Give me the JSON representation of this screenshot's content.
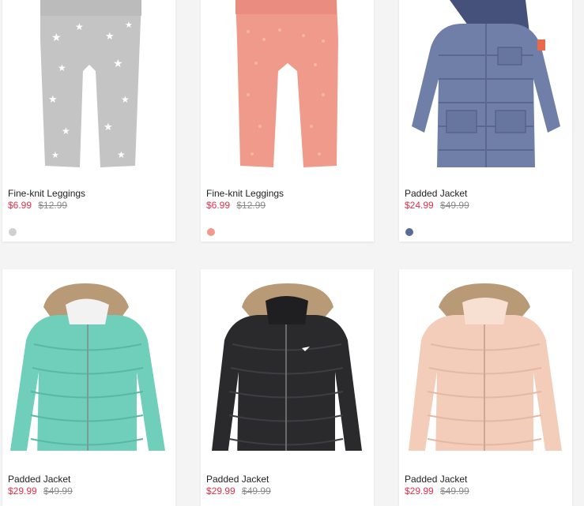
{
  "products": [
    {
      "name": "Fine-knit Leggings",
      "sale_price": "$6.99",
      "original_price": "$12.99",
      "swatch_color": "#cfcfcf",
      "image": "gray-star-leggings"
    },
    {
      "name": "Fine-knit Leggings",
      "sale_price": "$6.99",
      "original_price": "$12.99",
      "swatch_color": "#f2998a",
      "image": "pink-leggings"
    },
    {
      "name": "Padded Jacket",
      "sale_price": "$24.99",
      "original_price": "$49.99",
      "swatch_color": "#5b6b98",
      "image": "blue-padded-jacket"
    },
    {
      "name": "Padded Jacket",
      "sale_price": "$29.99",
      "original_price": "$49.99",
      "image": "mint-fur-hood-jacket"
    },
    {
      "name": "Padded Jacket",
      "sale_price": "$29.99",
      "original_price": "$49.99",
      "image": "black-fur-hood-jacket"
    },
    {
      "name": "Padded Jacket",
      "sale_price": "$29.99",
      "original_price": "$49.99",
      "image": "peach-fur-hood-jacket"
    }
  ],
  "colors": {
    "sale_price": "#e3324a",
    "original_price": "#8a8a8a",
    "leggings_gray": "#c4c4c4",
    "leggings_pink": "#f09a8c",
    "jacket_blue": "#6f7fa8",
    "jacket_mint": "#6fcfba",
    "jacket_black": "#2a2a2c",
    "jacket_peach": "#f3cdb9",
    "fur": "#b89a76"
  }
}
